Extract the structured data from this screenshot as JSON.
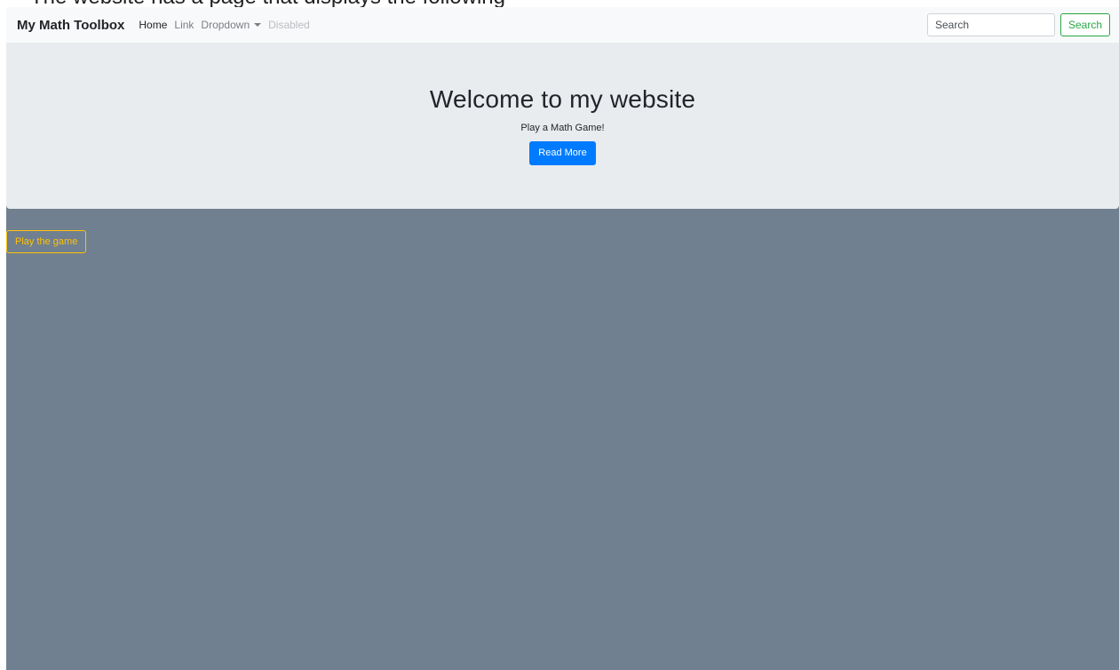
{
  "document_caption": "The website has a page that displays the following",
  "navbar": {
    "brand": "My Math Toolbox",
    "links": [
      {
        "label": "Home",
        "state": "active"
      },
      {
        "label": "Link",
        "state": "normal"
      },
      {
        "label": "Dropdown",
        "state": "dropdown"
      },
      {
        "label": "Disabled",
        "state": "disabled"
      }
    ],
    "search": {
      "placeholder": "Search",
      "value": "",
      "button_label": "Search"
    }
  },
  "jumbotron": {
    "title": "Welcome to my website",
    "subtitle": "Play a Math Game!",
    "button_label": "Read More"
  },
  "main": {
    "play_button_label": "Play the game"
  },
  "colors": {
    "page_background": "#708090",
    "navbar_background": "#f8f9fa",
    "jumbotron_background": "#e9ecef",
    "primary": "#007bff",
    "success": "#28a745",
    "warning": "#ffc107"
  },
  "icons": {
    "dropdown": "caret-down-icon"
  }
}
